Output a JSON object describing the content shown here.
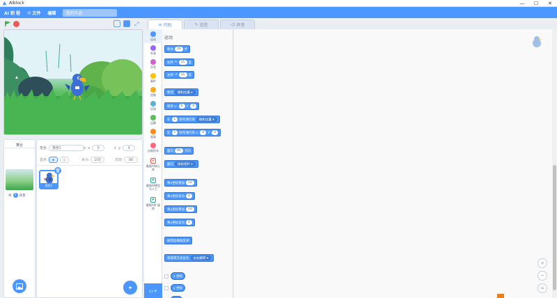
{
  "window": {
    "title": "AIblock",
    "minimize": "—",
    "maximize": "☐",
    "close": "✕"
  },
  "menubar": {
    "brand": "AI 积 程",
    "menu_file": "文件",
    "menu_edit": "编辑",
    "project_title": "我的作品"
  },
  "tabs": [
    {
      "label": "代码",
      "icon": "code-icon"
    },
    {
      "label": "造型",
      "icon": "brush-icon"
    },
    {
      "label": "声音",
      "icon": "speaker-icon"
    }
  ],
  "categories": [
    {
      "label": "运动",
      "color": "#4c97ff"
    },
    {
      "label": "外观",
      "color": "#9966ff"
    },
    {
      "label": "声音",
      "color": "#cf63cf"
    },
    {
      "label": "事件",
      "color": "#ffbf00"
    },
    {
      "label": "控制",
      "color": "#ffab19"
    },
    {
      "label": "侦测",
      "color": "#5cb1d6"
    },
    {
      "label": "运算",
      "color": "#59c059"
    },
    {
      "label": "变量",
      "color": "#ff8c1a"
    },
    {
      "label": "自制积木",
      "color": "#ff6680"
    },
    {
      "label": "截图AI核心库",
      "color": "#e05a4a"
    },
    {
      "label": "截图AI模型与人工",
      "color": "#2ca89a"
    },
    {
      "label": "截图AI扩展库",
      "color": "#2ca89a"
    }
  ],
  "palette": {
    "heading": "运动",
    "blocks": [
      {
        "parts": [
          "移动",
          "10",
          "步"
        ]
      },
      {
        "parts": [
          "右转",
          "↻",
          "15",
          "度"
        ]
      },
      {
        "parts": [
          "左转",
          "↺",
          "15",
          "度"
        ]
      },
      {
        "parts": [
          "移到",
          "随机位置 ▾"
        ]
      },
      {
        "parts": [
          "移到 x:",
          "0",
          "y:",
          "0"
        ]
      },
      {
        "parts": [
          "在",
          "1",
          "秒内滑行到",
          "随机位置 ▾"
        ]
      },
      {
        "parts": [
          "在",
          "1",
          "秒内滑行到 x:",
          "0",
          "y:",
          "0"
        ]
      },
      {
        "parts": [
          "面向",
          "90",
          "方向"
        ]
      },
      {
        "parts": [
          "面向",
          "鼠标指针 ▾"
        ]
      },
      {
        "parts": [
          "将x坐标增加",
          "10"
        ]
      },
      {
        "parts": [
          "将x坐标设为",
          "0"
        ]
      },
      {
        "parts": [
          "将y坐标增加",
          "10"
        ]
      },
      {
        "parts": [
          "将y坐标设为",
          "0"
        ]
      },
      {
        "parts": [
          "碰到边缘就反弹"
        ]
      },
      {
        "parts": [
          "将旋转方式设为",
          "左右翻转 ▾"
        ]
      }
    ],
    "reporters": [
      "x 坐标",
      "y 坐标",
      "方向"
    ]
  },
  "sprite_info": {
    "role_label": "角色",
    "role_value": "角色1",
    "x_value": "0",
    "y_value": "0",
    "show_label": "显示",
    "size_label": "大小",
    "size_value": "100",
    "direction_label": "方向",
    "direction_value": "90"
  },
  "sprites": [
    {
      "name": "角色1",
      "caption": "嗨..喵"
    }
  ],
  "stage_panel": {
    "title": "舞台",
    "backdrops_label": "背景",
    "backdrops_count": "1"
  },
  "zoom": {
    "in": "+",
    "out": "−",
    "reset": "="
  }
}
